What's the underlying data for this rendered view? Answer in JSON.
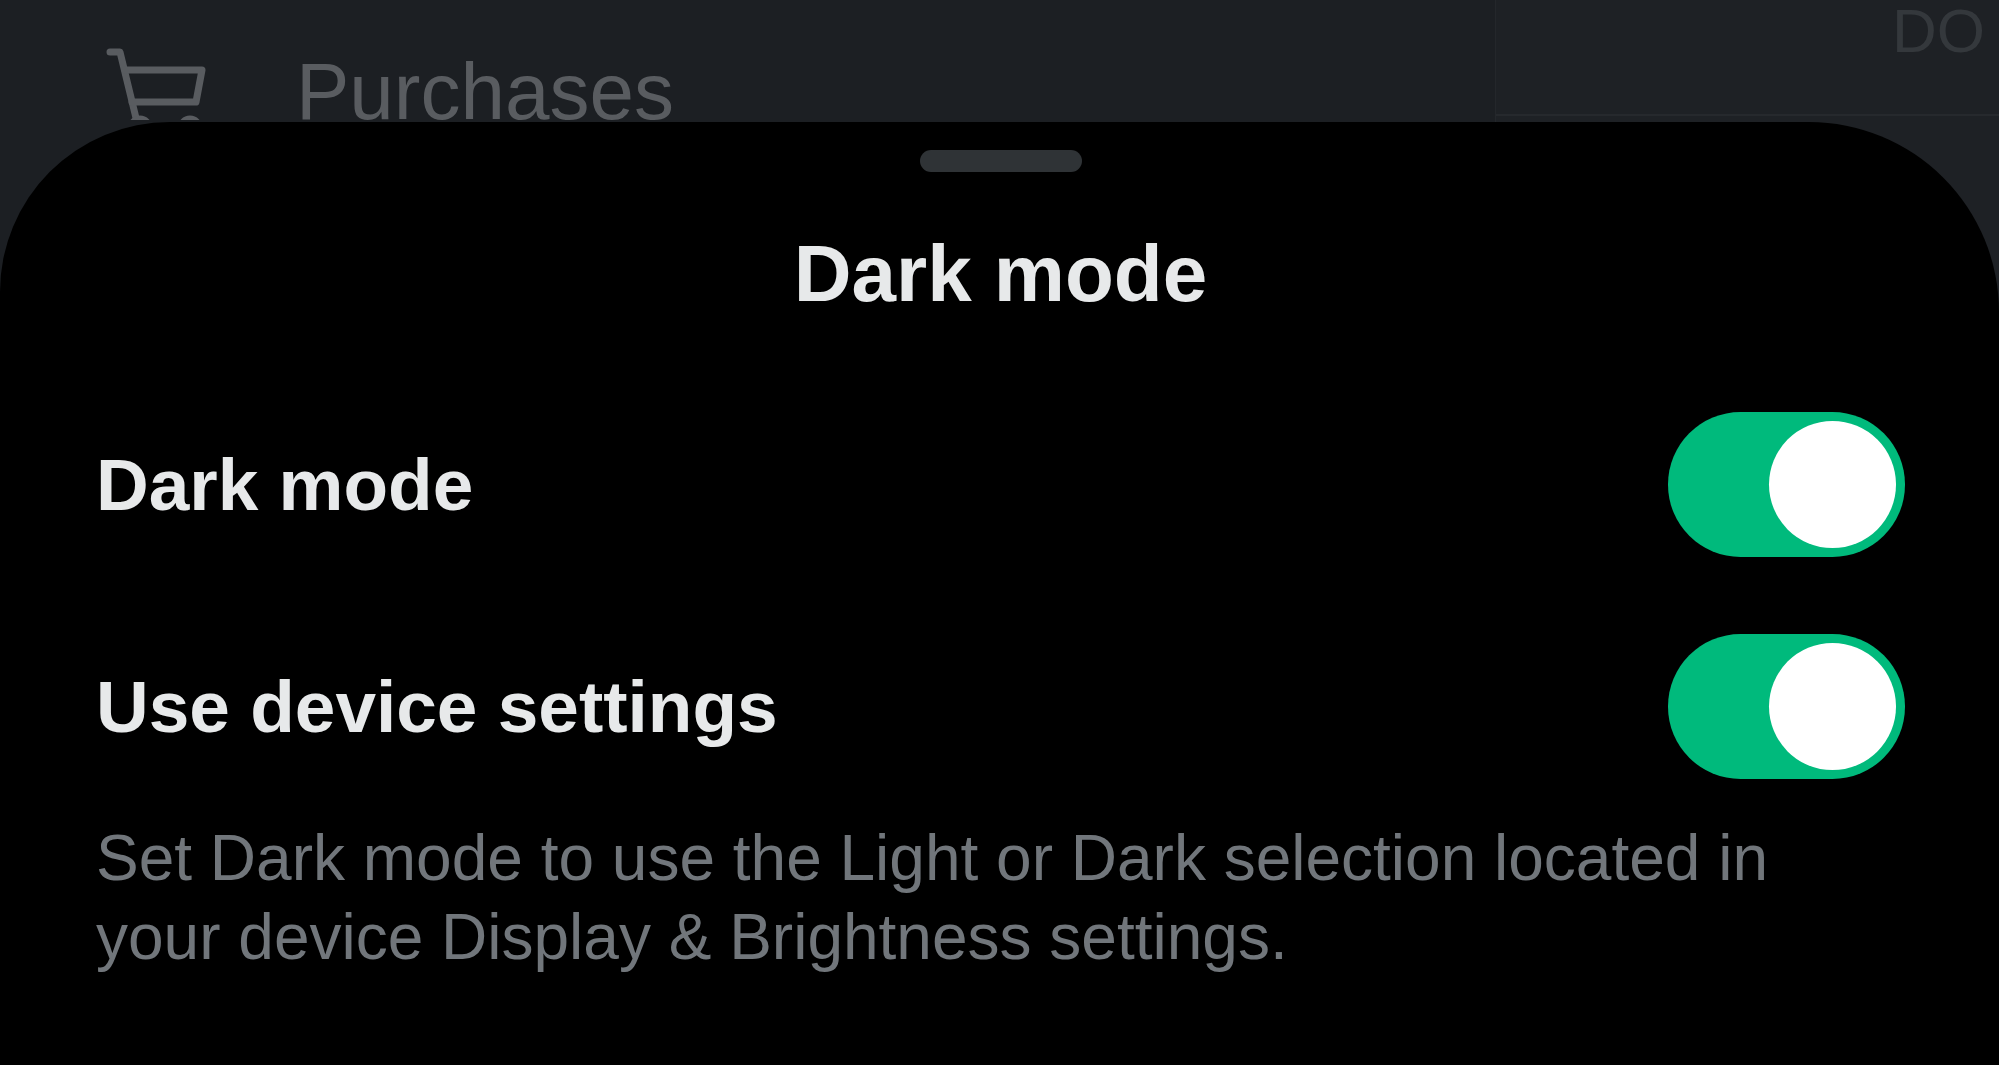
{
  "background": {
    "menu_item": {
      "label": "Purchases"
    },
    "side_panel": {
      "heading": "DO"
    }
  },
  "sheet": {
    "title": "Dark mode",
    "settings": [
      {
        "label": "Dark mode",
        "on": true
      },
      {
        "label": "Use device settings",
        "on": true
      }
    ],
    "description": "Set Dark mode to use the Light or Dark selection located in your device Display & Brightness settings."
  }
}
